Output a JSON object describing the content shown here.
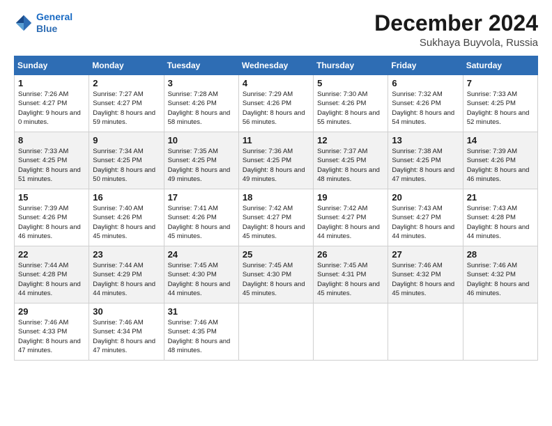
{
  "logo": {
    "line1": "General",
    "line2": "Blue"
  },
  "header": {
    "title": "December 2024",
    "subtitle": "Sukhaya Buyvola, Russia"
  },
  "weekdays": [
    "Sunday",
    "Monday",
    "Tuesday",
    "Wednesday",
    "Thursday",
    "Friday",
    "Saturday"
  ],
  "weeks": [
    [
      {
        "day": 1,
        "sunrise": "7:26 AM",
        "sunset": "4:27 PM",
        "daylight": "9 hours and 0 minutes."
      },
      {
        "day": 2,
        "sunrise": "7:27 AM",
        "sunset": "4:27 PM",
        "daylight": "8 hours and 59 minutes."
      },
      {
        "day": 3,
        "sunrise": "7:28 AM",
        "sunset": "4:26 PM",
        "daylight": "8 hours and 58 minutes."
      },
      {
        "day": 4,
        "sunrise": "7:29 AM",
        "sunset": "4:26 PM",
        "daylight": "8 hours and 56 minutes."
      },
      {
        "day": 5,
        "sunrise": "7:30 AM",
        "sunset": "4:26 PM",
        "daylight": "8 hours and 55 minutes."
      },
      {
        "day": 6,
        "sunrise": "7:32 AM",
        "sunset": "4:26 PM",
        "daylight": "8 hours and 54 minutes."
      },
      {
        "day": 7,
        "sunrise": "7:33 AM",
        "sunset": "4:25 PM",
        "daylight": "8 hours and 52 minutes."
      }
    ],
    [
      {
        "day": 8,
        "sunrise": "7:33 AM",
        "sunset": "4:25 PM",
        "daylight": "8 hours and 51 minutes."
      },
      {
        "day": 9,
        "sunrise": "7:34 AM",
        "sunset": "4:25 PM",
        "daylight": "8 hours and 50 minutes."
      },
      {
        "day": 10,
        "sunrise": "7:35 AM",
        "sunset": "4:25 PM",
        "daylight": "8 hours and 49 minutes."
      },
      {
        "day": 11,
        "sunrise": "7:36 AM",
        "sunset": "4:25 PM",
        "daylight": "8 hours and 49 minutes."
      },
      {
        "day": 12,
        "sunrise": "7:37 AM",
        "sunset": "4:25 PM",
        "daylight": "8 hours and 48 minutes."
      },
      {
        "day": 13,
        "sunrise": "7:38 AM",
        "sunset": "4:25 PM",
        "daylight": "8 hours and 47 minutes."
      },
      {
        "day": 14,
        "sunrise": "7:39 AM",
        "sunset": "4:26 PM",
        "daylight": "8 hours and 46 minutes."
      }
    ],
    [
      {
        "day": 15,
        "sunrise": "7:39 AM",
        "sunset": "4:26 PM",
        "daylight": "8 hours and 46 minutes."
      },
      {
        "day": 16,
        "sunrise": "7:40 AM",
        "sunset": "4:26 PM",
        "daylight": "8 hours and 45 minutes."
      },
      {
        "day": 17,
        "sunrise": "7:41 AM",
        "sunset": "4:26 PM",
        "daylight": "8 hours and 45 minutes."
      },
      {
        "day": 18,
        "sunrise": "7:42 AM",
        "sunset": "4:27 PM",
        "daylight": "8 hours and 45 minutes."
      },
      {
        "day": 19,
        "sunrise": "7:42 AM",
        "sunset": "4:27 PM",
        "daylight": "8 hours and 44 minutes."
      },
      {
        "day": 20,
        "sunrise": "7:43 AM",
        "sunset": "4:27 PM",
        "daylight": "8 hours and 44 minutes."
      },
      {
        "day": 21,
        "sunrise": "7:43 AM",
        "sunset": "4:28 PM",
        "daylight": "8 hours and 44 minutes."
      }
    ],
    [
      {
        "day": 22,
        "sunrise": "7:44 AM",
        "sunset": "4:28 PM",
        "daylight": "8 hours and 44 minutes."
      },
      {
        "day": 23,
        "sunrise": "7:44 AM",
        "sunset": "4:29 PM",
        "daylight": "8 hours and 44 minutes."
      },
      {
        "day": 24,
        "sunrise": "7:45 AM",
        "sunset": "4:30 PM",
        "daylight": "8 hours and 44 minutes."
      },
      {
        "day": 25,
        "sunrise": "7:45 AM",
        "sunset": "4:30 PM",
        "daylight": "8 hours and 45 minutes."
      },
      {
        "day": 26,
        "sunrise": "7:45 AM",
        "sunset": "4:31 PM",
        "daylight": "8 hours and 45 minutes."
      },
      {
        "day": 27,
        "sunrise": "7:46 AM",
        "sunset": "4:32 PM",
        "daylight": "8 hours and 45 minutes."
      },
      {
        "day": 28,
        "sunrise": "7:46 AM",
        "sunset": "4:32 PM",
        "daylight": "8 hours and 46 minutes."
      }
    ],
    [
      {
        "day": 29,
        "sunrise": "7:46 AM",
        "sunset": "4:33 PM",
        "daylight": "8 hours and 47 minutes."
      },
      {
        "day": 30,
        "sunrise": "7:46 AM",
        "sunset": "4:34 PM",
        "daylight": "8 hours and 47 minutes."
      },
      {
        "day": 31,
        "sunrise": "7:46 AM",
        "sunset": "4:35 PM",
        "daylight": "8 hours and 48 minutes."
      },
      null,
      null,
      null,
      null
    ]
  ]
}
